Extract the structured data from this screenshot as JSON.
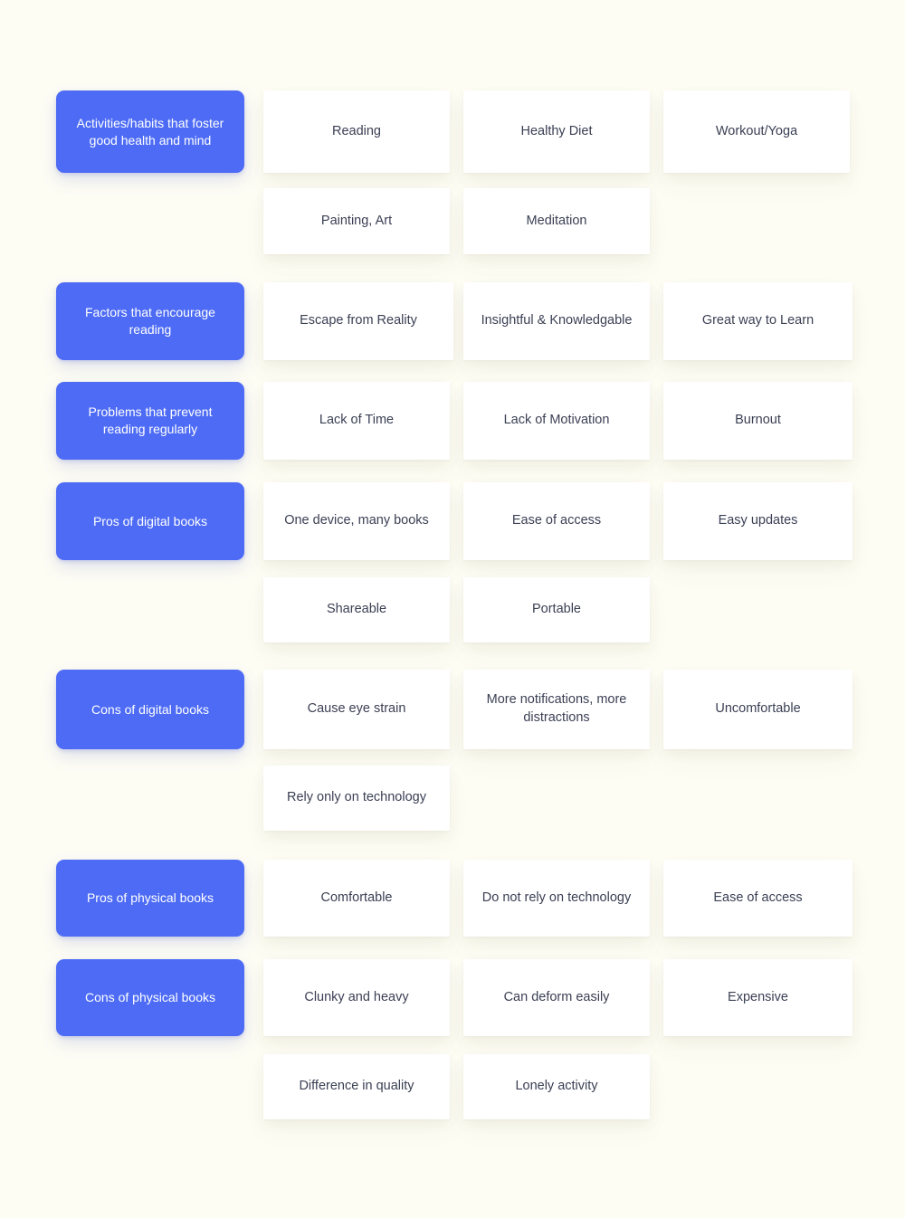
{
  "theme": {
    "background_color": "#fefdf4",
    "label_card_color": "#4d6bf5",
    "label_text_color": "#ffffff",
    "idea_card_color": "#ffffff",
    "idea_text_color": "#3b4054"
  },
  "board": {
    "type": "affinity-diagram",
    "groups": [
      {
        "label": "Activities/habits that foster good health and mind",
        "items": [
          "Reading",
          "Healthy Diet",
          "Workout/Yoga",
          "Painting, Art",
          "Meditation"
        ]
      },
      {
        "label": "Factors that encourage reading",
        "items": [
          "Escape from Reality",
          "Insightful & Knowledgable",
          "Great way to Learn"
        ]
      },
      {
        "label": "Problems that prevent reading regularly",
        "items": [
          "Lack of Time",
          "Lack of Motivation",
          "Burnout"
        ]
      },
      {
        "label": "Pros of digital books",
        "items": [
          "One device, many books",
          "Ease of access",
          "Easy updates",
          "Shareable",
          "Portable"
        ]
      },
      {
        "label": "Cons of digital books",
        "items": [
          "Cause eye strain",
          "More notifications, more distractions",
          "Uncomfortable",
          "Rely only on technology"
        ]
      },
      {
        "label": "Pros of physical books",
        "items": [
          "Comfortable",
          "Do not rely on technology",
          "Ease of access"
        ]
      },
      {
        "label": "Cons of physical books",
        "items": [
          "Clunky and heavy",
          "Can deform easily",
          "Expensive",
          "Difference in quality",
          "Lonely activity"
        ]
      }
    ]
  },
  "labels": {
    "g0": "Activities/habits that foster good health and mind",
    "g1": "Factors that encourage reading",
    "g2": "Problems that prevent reading regularly",
    "g3": "Pros of digital books",
    "g4": "Cons of digital books",
    "g5": "Pros of physical books",
    "g6": "Cons of physical books"
  },
  "cells": {
    "r1c1": "Reading",
    "r1c2": "Healthy Diet",
    "r1c3": "Workout/Yoga",
    "r2c1": "Painting, Art",
    "r2c2": "Meditation",
    "r3c1": "Escape from Reality",
    "r3c2": "Insightful & Knowledgable",
    "r3c3": "Great way to Learn",
    "r4c1": "Lack of Time",
    "r4c2": "Lack of Motivation",
    "r4c3": "Burnout",
    "r5c1": "One device, many books",
    "r5c2": "Ease of access",
    "r5c3": "Easy updates",
    "r6c1": "Shareable",
    "r6c2": "Portable",
    "r7c1": "Cause eye strain",
    "r7c2": "More notifications, more distractions",
    "r7c3": "Uncomfortable",
    "r8c1": "Rely only on technology",
    "r9c1": "Comfortable",
    "r9c2": "Do not rely on technology",
    "r9c3": "Ease of access",
    "r10c1": "Clunky and heavy",
    "r10c2": "Can deform easily",
    "r10c3": "Expensive",
    "r11c1": "Difference in quality",
    "r11c2": "Lonely activity"
  }
}
